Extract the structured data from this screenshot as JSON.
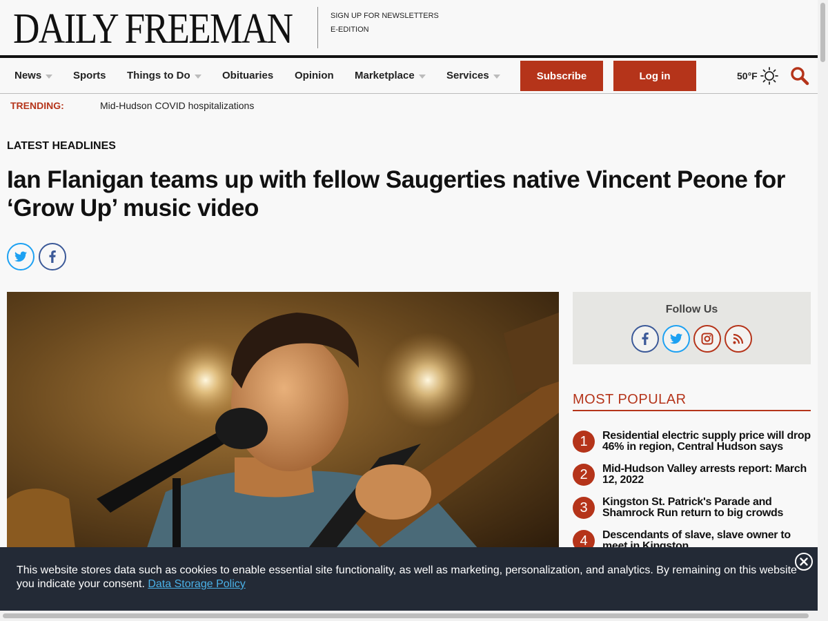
{
  "masthead": {
    "logo": "DAILY FREEMAN",
    "links": [
      "SIGN UP FOR NEWSLETTERS",
      "E-EDITION"
    ]
  },
  "nav": {
    "items": [
      {
        "label": "News",
        "dropdown": true
      },
      {
        "label": "Sports",
        "dropdown": false
      },
      {
        "label": "Things to Do",
        "dropdown": true
      },
      {
        "label": "Obituaries",
        "dropdown": false
      },
      {
        "label": "Opinion",
        "dropdown": false
      },
      {
        "label": "Marketplace",
        "dropdown": true
      },
      {
        "label": "Services",
        "dropdown": true
      }
    ],
    "subscribe_label": "Subscribe",
    "login_label": "Log in",
    "temperature": "50°F",
    "weather_icon": "sun-icon",
    "search_icon": "search-icon"
  },
  "trending": {
    "label": "TRENDING:",
    "link": "Mid-Hudson COVID hospitalizations"
  },
  "article": {
    "section": "LATEST HEADLINES",
    "headline": "Ian Flanigan teams up with fellow Saugerties native Vincent Peone for ‘Grow Up’ music video",
    "share_icons": [
      "twitter-icon",
      "facebook-icon"
    ]
  },
  "sidebar": {
    "follow_title": "Follow Us",
    "follow_icons": [
      "facebook-icon",
      "twitter-icon",
      "instagram-icon",
      "rss-icon"
    ],
    "popular_title": "MOST POPULAR",
    "popular": [
      {
        "rank": "1",
        "title": "Residential electric supply price will drop 46% in region, Central Hudson says"
      },
      {
        "rank": "2",
        "title": "Mid-Hudson Valley arrests report: March 12, 2022"
      },
      {
        "rank": "3",
        "title": "Kingston St. Patrick's Parade and Shamrock Run return to big crowds"
      },
      {
        "rank": "4",
        "title": "Descendants of slave, slave owner to meet in Kingston"
      }
    ]
  },
  "cookie": {
    "text": "This website stores data such as cookies to enable essential site functionality, as well as marketing, personalization, and analytics. By remaining on this website you indicate your consent.",
    "link": "Data Storage Policy"
  },
  "colors": {
    "brand_red": "#b5341a",
    "twitter_blue": "#1da1f2",
    "facebook_blue": "#3b5998",
    "banner_bg": "#232a36"
  }
}
